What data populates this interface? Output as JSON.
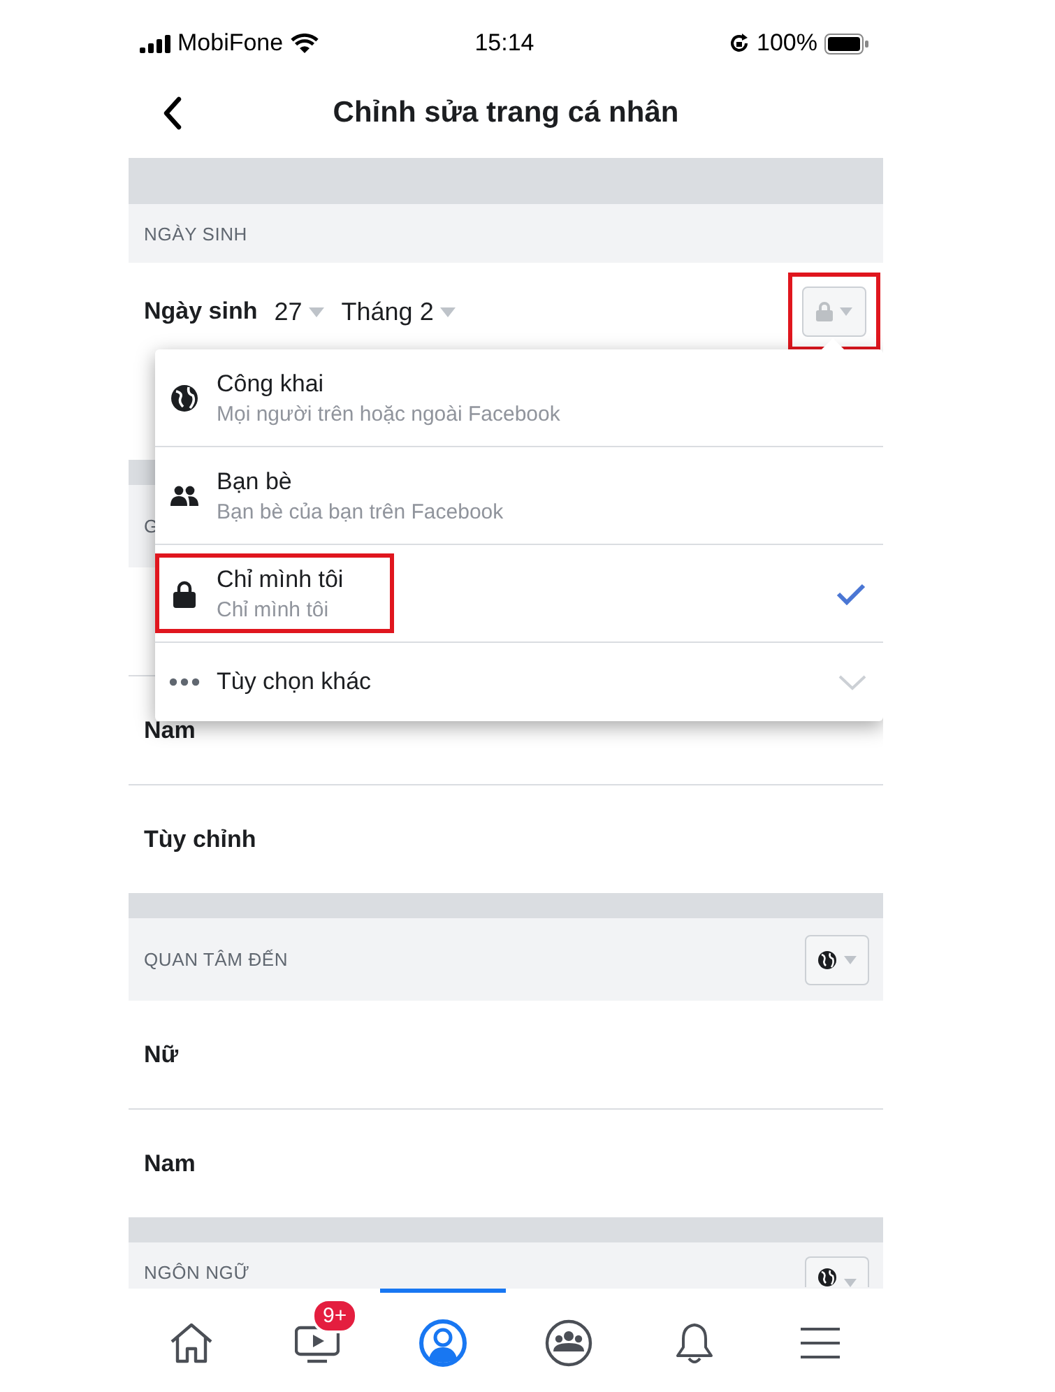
{
  "status_bar": {
    "carrier": "MobiFone",
    "time": "15:14",
    "battery": "100%"
  },
  "header": {
    "title": "Chỉnh sửa trang cá nhân"
  },
  "sections": [
    {
      "header": "NGÀY SINH",
      "rows": [
        {
          "kind": "birthday",
          "label": "Ngày sinh",
          "day": "27",
          "month": "Tháng 2",
          "privacy": {
            "kind": "lock",
            "highlighted": true
          }
        },
        {
          "kind": "covered"
        }
      ]
    },
    {
      "header": "G",
      "rows": [
        {
          "kind": "covered"
        },
        {
          "kind": "plain",
          "label": "Nam"
        },
        {
          "kind": "plain",
          "label": "Tùy chỉnh"
        }
      ]
    },
    {
      "header": "QUAN TÂM ĐẾN",
      "privacy": {
        "kind": "globe",
        "highlighted": false
      },
      "rows": [
        {
          "kind": "plain",
          "label": "Nữ"
        },
        {
          "kind": "plain",
          "label": "Nam"
        }
      ]
    },
    {
      "header": "NGÔN NGỮ",
      "privacy": {
        "kind": "globe",
        "highlighted": false
      }
    }
  ],
  "privacy_menu": {
    "items": [
      {
        "kind": "globe",
        "title": "Công khai",
        "subtitle": "Mọi người trên hoặc ngoài Facebook",
        "selected": false,
        "highlighted": false
      },
      {
        "kind": "friends",
        "title": "Bạn bè",
        "subtitle": "Bạn bè của bạn trên Facebook",
        "selected": false,
        "highlighted": false
      },
      {
        "kind": "lock",
        "title": "Chỉ mình tôi",
        "subtitle": "Chỉ mình tôi",
        "selected": true,
        "highlighted": true
      },
      {
        "kind": "more",
        "title": "Tùy chọn khác",
        "selected": false,
        "highlighted": false
      }
    ]
  },
  "tab_bar": {
    "tabs": [
      {
        "kind": "home",
        "selected": false
      },
      {
        "kind": "video",
        "badge": "9+",
        "selected": false
      },
      {
        "kind": "profile",
        "selected": true
      },
      {
        "kind": "groups",
        "selected": false
      },
      {
        "kind": "bell",
        "selected": false
      },
      {
        "kind": "menu",
        "selected": false
      }
    ]
  }
}
